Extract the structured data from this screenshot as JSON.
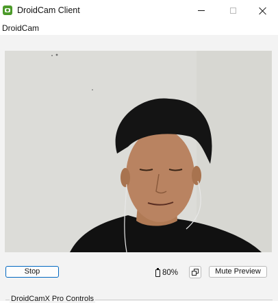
{
  "window": {
    "title": "DroidCam Client"
  },
  "menu": {
    "items": [
      "DroidCam"
    ]
  },
  "controls": {
    "stop_label": "Stop",
    "battery_level": "80%",
    "mute_label": "Mute Preview"
  },
  "pro_section": {
    "label": "DroidCamX Pro Controls"
  },
  "icons": {
    "app": "droidcam-app-icon",
    "battery": "battery-icon",
    "copy": "copy-icon"
  },
  "colors": {
    "accent": "#0067c0",
    "app_icon": "#4c9a2a",
    "client_bg": "#f3f3f3"
  }
}
